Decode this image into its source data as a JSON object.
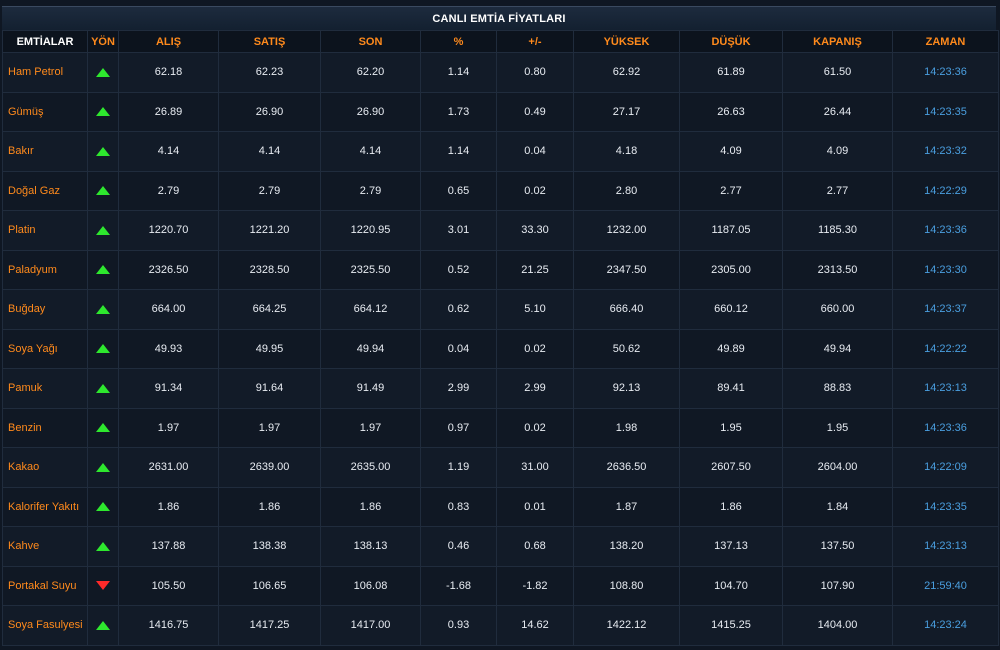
{
  "title": "CANLI EMTİA FİYATLARI",
  "columns": [
    "EMTİALAR",
    "YÖN",
    "ALIŞ",
    "SATIŞ",
    "SON",
    "%",
    "+/-",
    "YÜKSEK",
    "DÜŞÜK",
    "KAPANIŞ",
    "ZAMAN"
  ],
  "colors": {
    "name": "#ff8a1c",
    "time": "#4a9fe0",
    "up": "#2ee82e",
    "down": "#ff2a2a"
  },
  "rows": [
    {
      "name": "Ham Petrol",
      "dir": "up",
      "alis": "62.18",
      "satis": "62.23",
      "son": "62.20",
      "pct": "1.14",
      "diff": "0.80",
      "yuksek": "62.92",
      "dusuk": "61.89",
      "kapanis": "61.50",
      "zaman": "14:23:36"
    },
    {
      "name": "Gümüş",
      "dir": "up",
      "alis": "26.89",
      "satis": "26.90",
      "son": "26.90",
      "pct": "1.73",
      "diff": "0.49",
      "yuksek": "27.17",
      "dusuk": "26.63",
      "kapanis": "26.44",
      "zaman": "14:23:35"
    },
    {
      "name": "Bakır",
      "dir": "up",
      "alis": "4.14",
      "satis": "4.14",
      "son": "4.14",
      "pct": "1.14",
      "diff": "0.04",
      "yuksek": "4.18",
      "dusuk": "4.09",
      "kapanis": "4.09",
      "zaman": "14:23:32"
    },
    {
      "name": "Doğal Gaz",
      "dir": "up",
      "alis": "2.79",
      "satis": "2.79",
      "son": "2.79",
      "pct": "0.65",
      "diff": "0.02",
      "yuksek": "2.80",
      "dusuk": "2.77",
      "kapanis": "2.77",
      "zaman": "14:22:29"
    },
    {
      "name": "Platin",
      "dir": "up",
      "alis": "1220.70",
      "satis": "1221.20",
      "son": "1220.95",
      "pct": "3.01",
      "diff": "33.30",
      "yuksek": "1232.00",
      "dusuk": "1187.05",
      "kapanis": "1185.30",
      "zaman": "14:23:36"
    },
    {
      "name": "Paladyum",
      "dir": "up",
      "alis": "2326.50",
      "satis": "2328.50",
      "son": "2325.50",
      "pct": "0.52",
      "diff": "21.25",
      "yuksek": "2347.50",
      "dusuk": "2305.00",
      "kapanis": "2313.50",
      "zaman": "14:23:30"
    },
    {
      "name": "Buğday",
      "dir": "up",
      "alis": "664.00",
      "satis": "664.25",
      "son": "664.12",
      "pct": "0.62",
      "diff": "5.10",
      "yuksek": "666.40",
      "dusuk": "660.12",
      "kapanis": "660.00",
      "zaman": "14:23:37"
    },
    {
      "name": "Soya Yağı",
      "dir": "up",
      "alis": "49.93",
      "satis": "49.95",
      "son": "49.94",
      "pct": "0.04",
      "diff": "0.02",
      "yuksek": "50.62",
      "dusuk": "49.89",
      "kapanis": "49.94",
      "zaman": "14:22:22"
    },
    {
      "name": "Pamuk",
      "dir": "up",
      "alis": "91.34",
      "satis": "91.64",
      "son": "91.49",
      "pct": "2.99",
      "diff": "2.99",
      "yuksek": "92.13",
      "dusuk": "89.41",
      "kapanis": "88.83",
      "zaman": "14:23:13"
    },
    {
      "name": "Benzin",
      "dir": "up",
      "alis": "1.97",
      "satis": "1.97",
      "son": "1.97",
      "pct": "0.97",
      "diff": "0.02",
      "yuksek": "1.98",
      "dusuk": "1.95",
      "kapanis": "1.95",
      "zaman": "14:23:36"
    },
    {
      "name": "Kakao",
      "dir": "up",
      "alis": "2631.00",
      "satis": "2639.00",
      "son": "2635.00",
      "pct": "1.19",
      "diff": "31.00",
      "yuksek": "2636.50",
      "dusuk": "2607.50",
      "kapanis": "2604.00",
      "zaman": "14:22:09"
    },
    {
      "name": "Kalorifer Yakıtı",
      "dir": "up",
      "alis": "1.86",
      "satis": "1.86",
      "son": "1.86",
      "pct": "0.83",
      "diff": "0.01",
      "yuksek": "1.87",
      "dusuk": "1.86",
      "kapanis": "1.84",
      "zaman": "14:23:35"
    },
    {
      "name": "Kahve",
      "dir": "up",
      "alis": "137.88",
      "satis": "138.38",
      "son": "138.13",
      "pct": "0.46",
      "diff": "0.68",
      "yuksek": "138.20",
      "dusuk": "137.13",
      "kapanis": "137.50",
      "zaman": "14:23:13"
    },
    {
      "name": "Portakal Suyu",
      "dir": "down",
      "alis": "105.50",
      "satis": "106.65",
      "son": "106.08",
      "pct": "-1.68",
      "diff": "-1.82",
      "yuksek": "108.80",
      "dusuk": "104.70",
      "kapanis": "107.90",
      "zaman": "21:59:40"
    },
    {
      "name": "Soya Fasulyesi",
      "dir": "up",
      "alis": "1416.75",
      "satis": "1417.25",
      "son": "1417.00",
      "pct": "0.93",
      "diff": "14.62",
      "yuksek": "1422.12",
      "dusuk": "1415.25",
      "kapanis": "1404.00",
      "zaman": "14:23:24"
    }
  ]
}
